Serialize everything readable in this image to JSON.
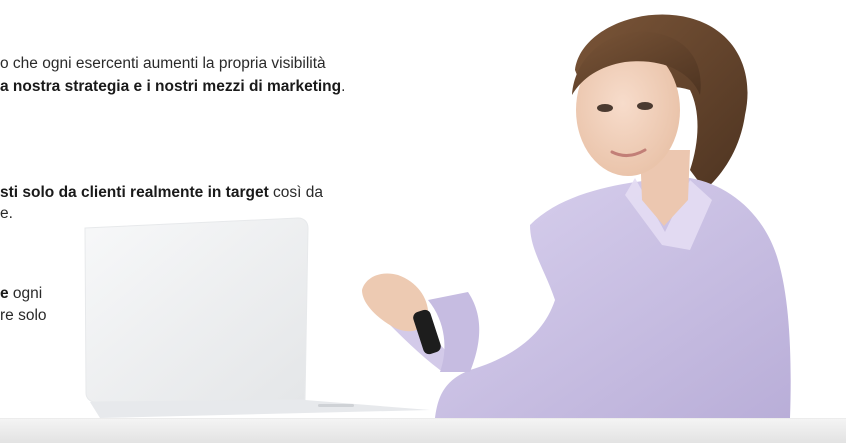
{
  "copy": {
    "line1": {
      "plain": "o che ogni esercenti aumenti la propria visibilità",
      "bold": ""
    },
    "line2": {
      "bold": "a nostra strategia e i nostri mezzi di marketing",
      "plain": "."
    },
    "line3": {
      "bold": "sti solo da clienti realmente in target",
      "plain": " così da"
    },
    "line4": {
      "plain": "e."
    },
    "line5": {
      "bold": "e",
      "plain": " ogni"
    },
    "line6": {
      "plain": "re solo"
    }
  },
  "colors": {
    "background": "#ffffff",
    "text": "#2a2a2a",
    "shirt": "#c9c0e2",
    "hair": "#6b4a30",
    "skin": "#f1d2bd",
    "laptop": "#eef0f2"
  },
  "images": {
    "hero": "woman-with-laptop-photo"
  }
}
